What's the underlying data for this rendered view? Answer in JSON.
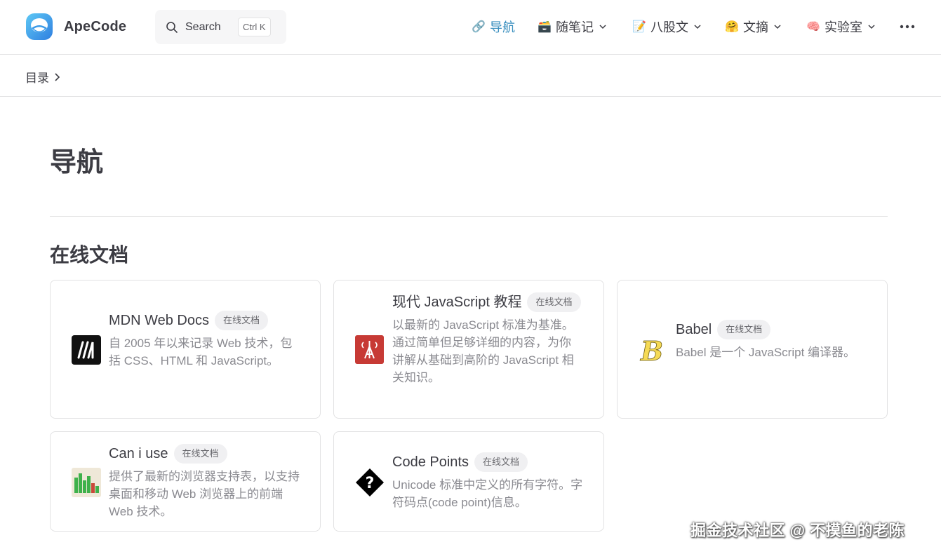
{
  "header": {
    "brand": "ApeCode",
    "search": {
      "label": "Search",
      "shortcut": "Ctrl K"
    },
    "nav": [
      {
        "label": "导航",
        "icon": "link-icon",
        "emoji": "🔗",
        "active": true,
        "dropdown": false
      },
      {
        "label": "随笔记",
        "icon": "card-file-box-icon",
        "emoji": "🗃️",
        "active": false,
        "dropdown": true
      },
      {
        "label": "八股文",
        "icon": "memo-icon",
        "emoji": "📝",
        "active": false,
        "dropdown": true
      },
      {
        "label": "文摘",
        "icon": "hugging-face-icon",
        "emoji": "🤗",
        "active": false,
        "dropdown": true
      },
      {
        "label": "实验室",
        "icon": "brain-icon",
        "emoji": "🧠",
        "active": false,
        "dropdown": true
      }
    ]
  },
  "breadcrumb": {
    "label": "目录"
  },
  "page": {
    "title": "导航",
    "section_title": "在线文档"
  },
  "cards": [
    {
      "name": "MDN Web Docs",
      "badge": "在线文档",
      "desc": "自 2005 年以来记录 Web 技术，包括 CSS、HTML 和 JavaScript。",
      "icon": "mdn-logo-icon"
    },
    {
      "name": "现代 JavaScript 教程",
      "badge": "在线文档",
      "desc": "以最新的 JavaScript 标准为基准。通过简单但足够详细的内容，为你讲解从基础到高阶的 JavaScript 相关知识。",
      "icon": "javascript-info-logo-icon"
    },
    {
      "name": "Babel",
      "badge": "在线文档",
      "desc": "Babel 是一个 JavaScript 编译器。",
      "icon": "babel-logo-icon"
    },
    {
      "name": "Can i use",
      "badge": "在线文档",
      "desc": "提供了最新的浏览器支持表，以支持桌面和移动 Web 浏览器上的前端 Web 技术。",
      "icon": "caniuse-logo-icon"
    },
    {
      "name": "Code Points",
      "badge": "在线文档",
      "desc": "Unicode 标准中定义的所有字符。字符码点(code point)信息。",
      "icon": "question-diamond-icon"
    }
  ],
  "watermark": "掘金技术社区 @ 不摸鱼的老陈",
  "colors": {
    "accent": "#3a8fbf",
    "text": "#3c3c43",
    "muted": "#8a8a90",
    "border": "#e2e2e3"
  }
}
